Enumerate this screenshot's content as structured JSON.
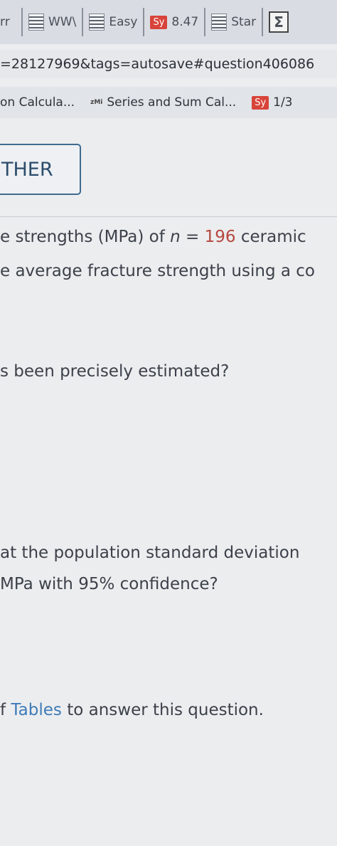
{
  "browser": {
    "tabs": [
      {
        "label": "rr",
        "icon": ""
      },
      {
        "label": "WW\\",
        "icon": "document-icon"
      },
      {
        "label": "Easy",
        "icon": "document-icon"
      },
      {
        "label": "8.47",
        "icon": "sy-badge",
        "badge": "Sy"
      },
      {
        "label": "Star",
        "icon": "document-icon"
      },
      {
        "label": "Σ",
        "icon": "sigma-icon"
      }
    ],
    "url": "=28127969&tags=autosave#question406086",
    "bookmarks": [
      {
        "label": "on Calcula...",
        "icon": ""
      },
      {
        "label": "Series and Sum Cal...",
        "icon": "zMi-icon",
        "icon_text": "zMi"
      },
      {
        "label": "1/3",
        "icon": "sy-badge",
        "badge": "Sy"
      }
    ]
  },
  "page": {
    "other_button": "THER",
    "line1_a": "e strengths (MPa) of ",
    "line1_n": "n",
    "line1_eq": " = ",
    "line1_num": "196",
    "line1_b": " ceramic",
    "line2": "e average fracture strength using a co",
    "line3": "s been precisely estimated?",
    "line4": "at the population standard deviation",
    "line5": " MPa with 95% confidence?",
    "line6_a": "f ",
    "line6_link": "Tables",
    "line6_b": " to answer this question."
  }
}
